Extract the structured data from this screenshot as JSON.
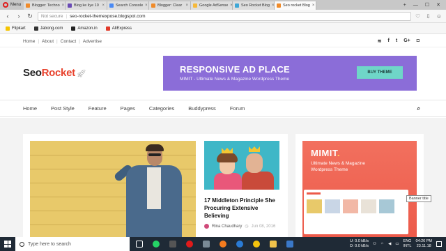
{
  "browser": {
    "menu_label": "Menu",
    "tabs": [
      {
        "label": "Blogger: Techno",
        "color": "#f08b2a"
      },
      {
        "label": "Blog ke liye 10",
        "color": "#6a4bb5"
      },
      {
        "label": "Search Console",
        "color": "#4a8af4"
      },
      {
        "label": "Blogger: Clear",
        "color": "#f08b2a"
      },
      {
        "label": "Google AdSense",
        "color": "#f6b93b"
      },
      {
        "label": "Seo Rocket Blog",
        "color": "#3fa7d6"
      },
      {
        "label": "Seo rocket Blog",
        "color": "#f08b2a"
      }
    ],
    "address": {
      "secure_label": "Not secure",
      "url": "seo-rocket-themexpose.blogspot.com"
    },
    "bookmarks": [
      {
        "label": "Flipkart",
        "color": "#f5c400"
      },
      {
        "label": "Jabong.com",
        "color": "#333333"
      },
      {
        "label": "Amazon.in",
        "color": "#222222"
      },
      {
        "label": "AliExpress",
        "color": "#e23a2a"
      }
    ]
  },
  "site": {
    "top_links": [
      "Home",
      "About",
      "Contact",
      "Advertise"
    ],
    "social_icons": [
      "rss-icon",
      "facebook-icon",
      "twitter-icon",
      "google-plus-icon",
      "instagram-icon"
    ],
    "logo": {
      "part1": "Seo",
      "part2": "Rocket",
      "accent": "#e8432e"
    },
    "ad": {
      "title": "RESPONSIVE AD PLACE",
      "subtitle": "MIMIT - Ultimate News & Magazine Wordpress Theme",
      "button": "BUY THEME",
      "bg": "#8b6dd8",
      "button_bg": "#6fd6c8"
    },
    "main_nav": [
      "Home",
      "Post Style",
      "Feature",
      "Pages",
      "Categories",
      "Buddypress",
      "Forum"
    ],
    "card2": {
      "title": "17 Middleton Principle She Procuring Extensive Believing",
      "author": "Rina Chaudhary",
      "date": "Jun 08, 2016"
    },
    "promo": {
      "title": "MIMIT",
      "dot": ".",
      "subtitle": "Ultimate News & Magazine Wordpress Theme",
      "tooltip": "Banner title"
    }
  },
  "taskbar": {
    "search_placeholder": "Type here to search",
    "speeds": {
      "up_label": "U:",
      "up": "0.0 kB/s",
      "down_label": "D:",
      "down": "0.0 kB/s"
    },
    "lang": "ENG",
    "region": "INTL",
    "time": "04:26 PM",
    "date": "23.11.18"
  }
}
